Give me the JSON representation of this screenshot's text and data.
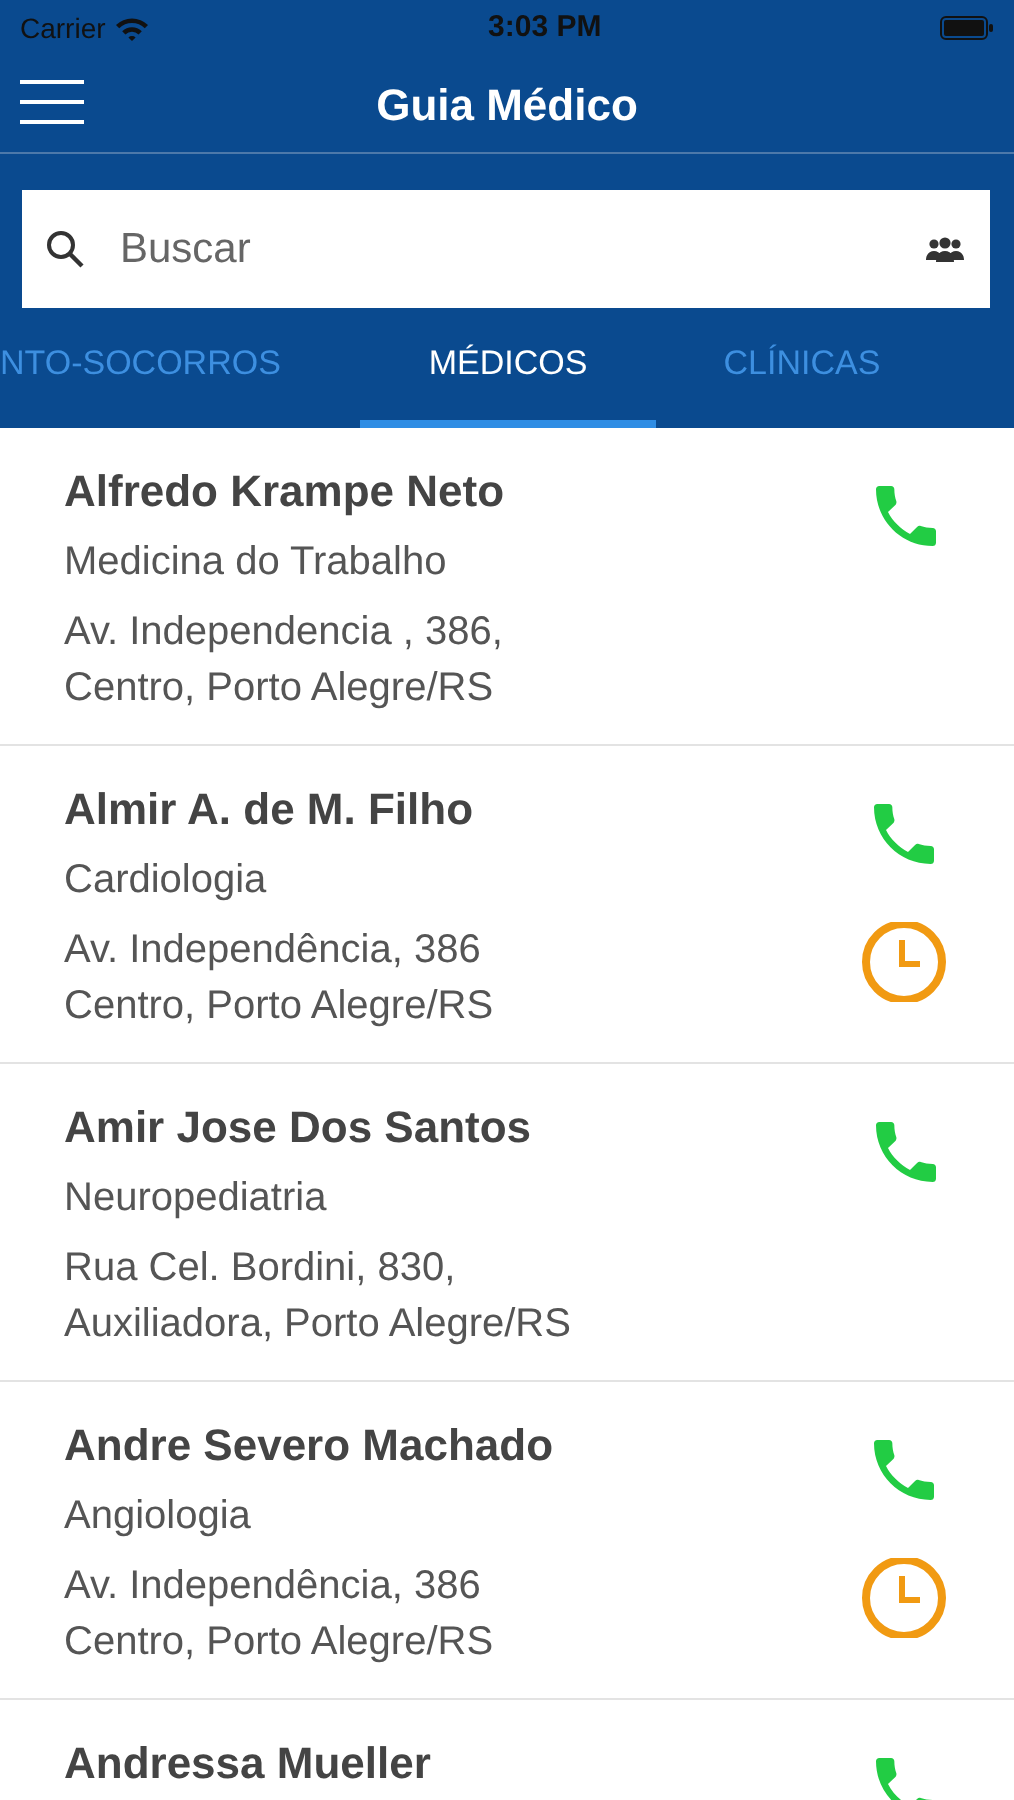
{
  "status_bar": {
    "carrier": "Carrier",
    "time": "3:03 PM"
  },
  "nav": {
    "title": "Guia Médico"
  },
  "search": {
    "placeholder": "Buscar"
  },
  "tabs": [
    {
      "label": "NTO-SOCORROS",
      "selected": false
    },
    {
      "label": "MÉDICOS",
      "selected": true
    },
    {
      "label": "CLÍNICAS",
      "selected": false
    }
  ],
  "doctors": [
    {
      "name": "Alfredo Krampe Neto",
      "specialty": "Medicina do Trabalho",
      "address_lines": [
        "Av. Independencia , 386,",
        "Centro, Porto Alegre/RS"
      ],
      "hours": false
    },
    {
      "name": "Almir A. de M. Filho",
      "specialty": "Cardiologia",
      "address_lines": [
        "Av. Independência, 386",
        "Centro, Porto Alegre/RS"
      ],
      "hours": true
    },
    {
      "name": "Amir Jose Dos Santos",
      "specialty": "Neuropediatria",
      "address_lines": [
        "Rua Cel. Bordini, 830,",
        "Auxiliadora, Porto Alegre/RS"
      ],
      "hours": false
    },
    {
      "name": "Andre Severo Machado",
      "specialty": "Angiologia",
      "address_lines": [
        "Av. Independência, 386",
        "Centro, Porto Alegre/RS"
      ],
      "hours": true
    },
    {
      "name": "Andressa Mueller",
      "hours": false
    }
  ]
}
